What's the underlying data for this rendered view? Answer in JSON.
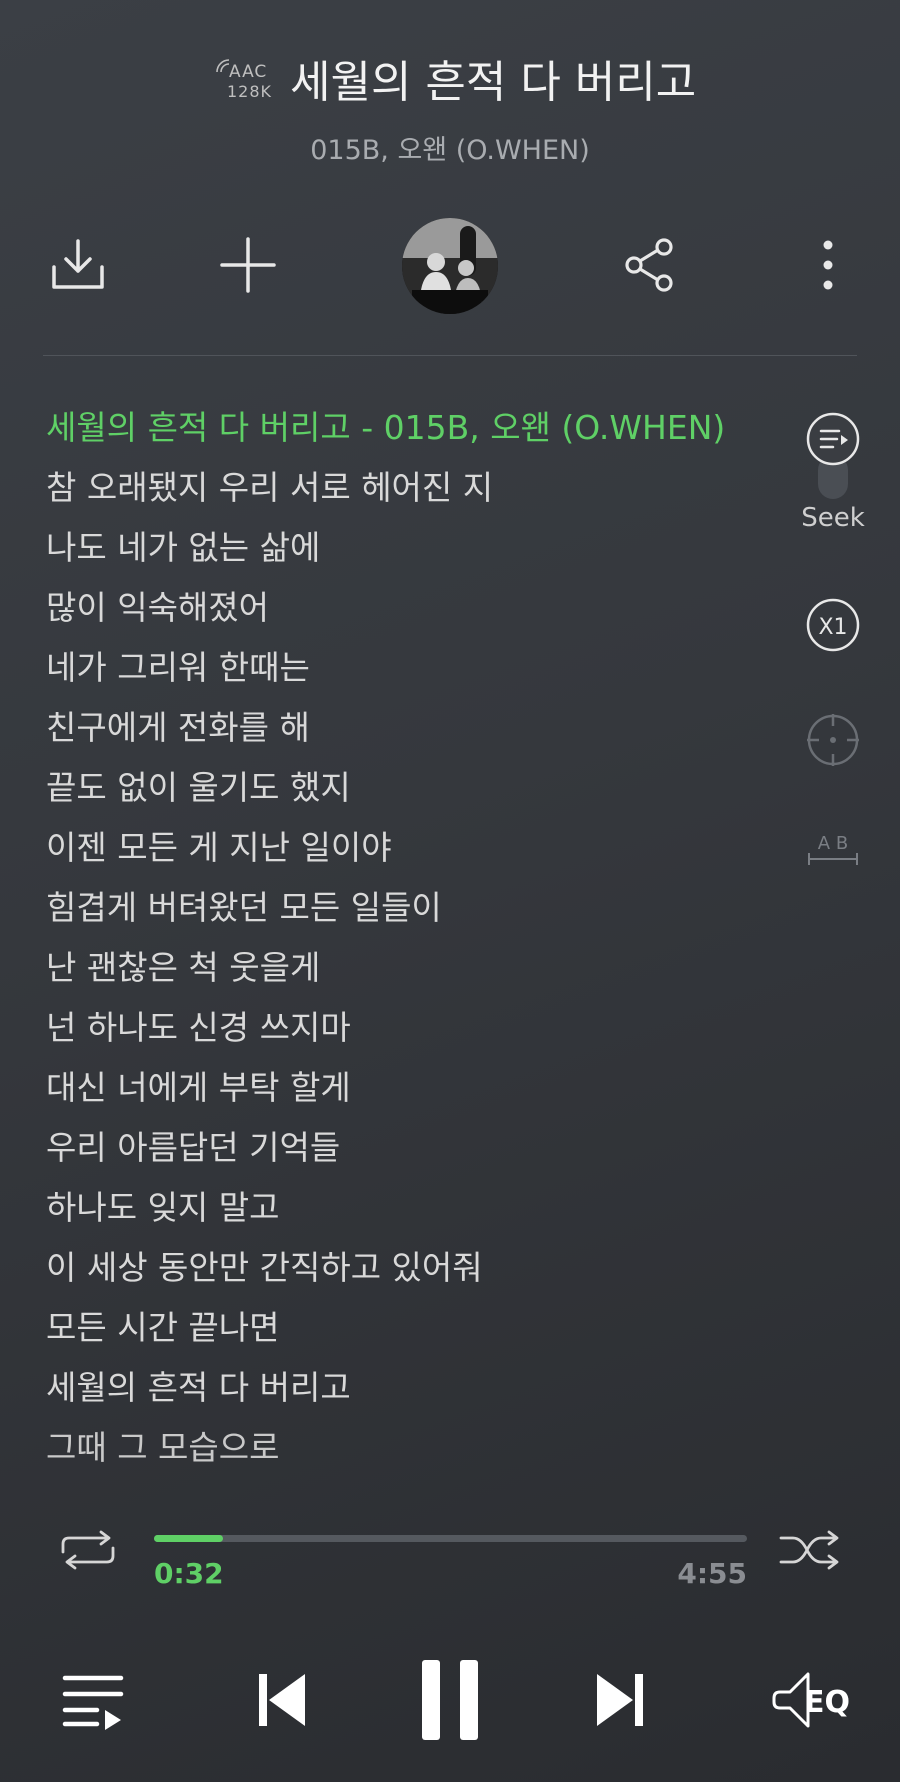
{
  "header": {
    "codec_line1": "AAC",
    "codec_line2": "128K",
    "title": "세월의 흔적 다 버리고",
    "artist": "015B, 오왠 (O.WHEN)"
  },
  "toolbar": {
    "icons": [
      "download-icon",
      "add-icon",
      "album-art",
      "share-icon",
      "more-icon"
    ]
  },
  "lyrics": {
    "lines": [
      "세월의 흔적 다 버리고 - 015B, 오왠 (O.WHEN)",
      "참 오래됐지 우리 서로 헤어진 지",
      "나도 네가 없는 삶에",
      "많이 익숙해졌어",
      "네가 그리워 한때는",
      "친구에게 전화를 해",
      "끝도 없이 울기도 했지",
      "이젠 모든 게 지난 일이야",
      "힘겹게 버텨왔던 모든 일들이",
      "난 괜찮은 척 웃을게",
      "넌 하나도 신경 쓰지마",
      "대신 너에게 부탁 할게",
      "우리 아름답던 기억들",
      "하나도 잊지 말고",
      "이 세상 동안만 간직하고 있어줘",
      "모든 시간 끝나면",
      "세월의 흔적 다 버리고",
      "그때 그 모습으로"
    ],
    "active_index": 0
  },
  "side": {
    "seek_label": "Seek",
    "speed_label": "X1",
    "ab_label": "A B"
  },
  "progress": {
    "current": "0:32",
    "total": "4:55",
    "fraction": 0.116
  },
  "controls": {
    "eq_label": "EQ"
  },
  "colors": {
    "accent": "#5fd066",
    "background": "#373a3f"
  }
}
